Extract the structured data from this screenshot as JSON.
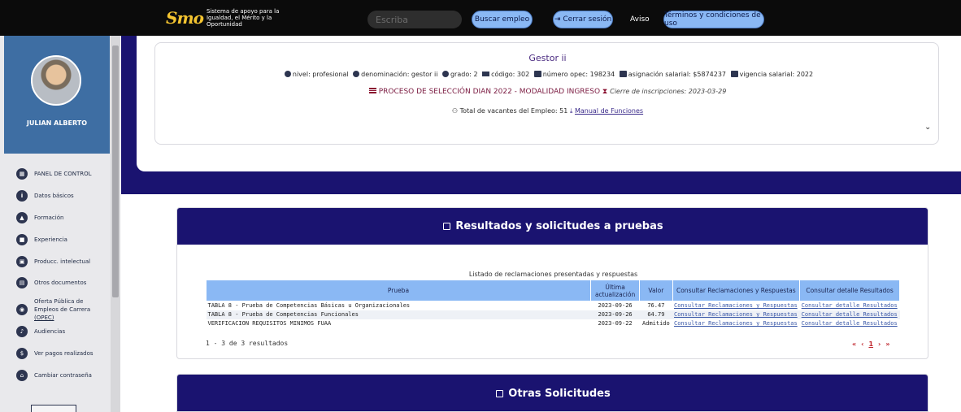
{
  "header": {
    "logo_mark": "Smo",
    "logo_text": "Sistema de apoyo para la Igualdad, el Mérito y la Oportunidad",
    "search_placeholder": "Escriba",
    "buscar_label": "Buscar empleo",
    "cerrar_label": "Cerrar sesión",
    "aviso_label": "Aviso",
    "terminos_label": "Términos y condiciones de uso"
  },
  "sidebar": {
    "user_name": "JULIAN ALBERTO",
    "items": [
      {
        "label": "PANEL DE CONTROL",
        "icon": "dashboard-icon"
      },
      {
        "label": "Datos básicos",
        "icon": "people-icon"
      },
      {
        "label": "Formación",
        "icon": "graduation-icon"
      },
      {
        "label": "Experiencia",
        "icon": "briefcase-icon"
      },
      {
        "label": "Producc. intelectual",
        "icon": "book-icon"
      },
      {
        "label": "Otros documentos",
        "icon": "document-icon"
      },
      {
        "label": "Oferta Pública de Empleos de Carrera",
        "label_link": "(OPEC)",
        "icon": "globe-icon"
      },
      {
        "label": "Audiencias",
        "icon": "audience-icon"
      },
      {
        "label": "Ver pagos realizados",
        "icon": "dollar-icon"
      },
      {
        "label": "Cambiar contraseña",
        "icon": "lock-icon"
      }
    ]
  },
  "job": {
    "title": "Gestor ii",
    "meta": {
      "nivel": "nivel: profesional",
      "denominacion": "denominación: gestor ii",
      "grado": "grado: 2",
      "codigo": "código: 302",
      "opec": "número opec: 198234",
      "asignacion": "asignación salarial: $5874237",
      "vigencia": "vigencia salarial: 2022"
    },
    "proceso": "PROCESO DE SELECCIÓN DIAN 2022 - MODALIDAD INGRESO",
    "cierre": "Cierre de inscripciones: 2023-03-29",
    "vacantes": "Total de vacantes del Empleo: 51",
    "manual_link": "Manual de Funciones"
  },
  "results": {
    "title": "Resultados y solicitudes a pruebas",
    "caption": "Listado de reclamaciones presentadas y respuestas",
    "columns": [
      "Prueba",
      "Última actualización",
      "Valor",
      "Consultar Reclamaciones y Respuestas",
      "Consultar detalle Resultados"
    ],
    "rows": [
      {
        "prueba": "TABLA 8 - Prueba de Competencias Básicas u Organizacionales",
        "fecha": "2023-09-26",
        "valor": "76.47",
        "consultar": "Consultar Reclamaciones y Respuestas",
        "detalle": "Consultar detalle Resultados"
      },
      {
        "prueba": "TABLA 8 - Prueba de Competencias Funcionales",
        "fecha": "2023-09-26",
        "valor": "64.79",
        "consultar": "Consultar Reclamaciones y Respuestas",
        "detalle": "Consultar detalle Resultados"
      },
      {
        "prueba": "VERIFICACION REQUISITOS MINIMOS FUAA",
        "fecha": "2023-09-22",
        "valor": "Admitido",
        "consultar": "Consultar Reclamaciones y Respuestas",
        "detalle": "Consultar detalle Resultados"
      }
    ],
    "count": "1 - 3 de 3 resultados",
    "pager": {
      "first": "«",
      "prev": "‹",
      "page": "1",
      "next": "›",
      "last": "»"
    }
  },
  "otras": {
    "title": "Otras Solicitudes"
  },
  "colors": {
    "navy": "#1a1370",
    "accent_blue": "#8ab8f4",
    "sidebar_profile": "#3e6ea3"
  }
}
